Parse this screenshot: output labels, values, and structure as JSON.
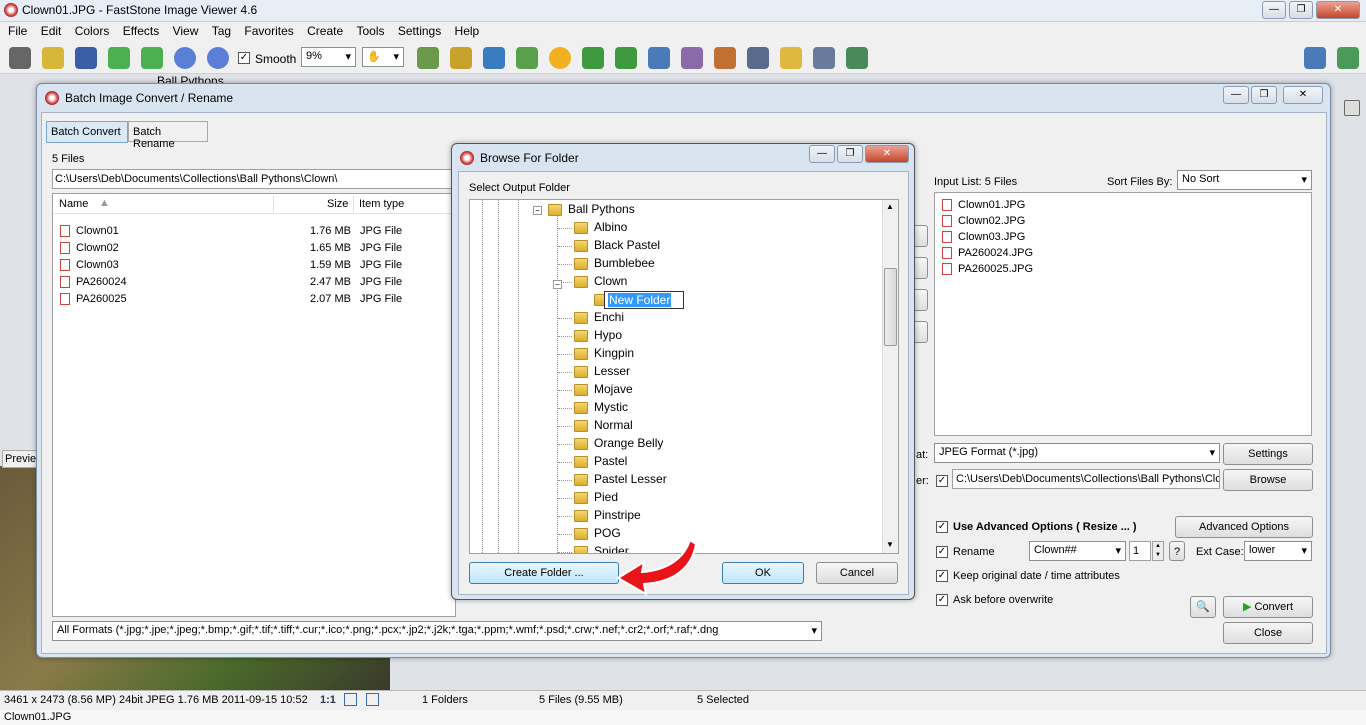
{
  "app": {
    "title": "Clown01.JPG  -  FastStone Image Viewer 4.6",
    "menu": [
      "File",
      "Edit",
      "Colors",
      "Effects",
      "View",
      "Tag",
      "Favorites",
      "Create",
      "Tools",
      "Settings",
      "Help"
    ],
    "smooth_label": "Smooth",
    "zoom_value": "9%",
    "behind_tree_item": "Ball Pythons",
    "preview_tab": "Previe"
  },
  "status": {
    "image_info": "3461 x 2473 (8.56 MP)  24bit  JPEG  1.76 MB  2011-09-15 10:52",
    "ratio": "1:1",
    "folders": "1 Folders",
    "files": "5 Files (9.55 MB)",
    "selected": "5 Selected",
    "filename": "Clown01.JPG"
  },
  "batch": {
    "title": "Batch Image Convert / Rename",
    "tabs": [
      "Batch Convert",
      "Batch Rename"
    ],
    "file_count": "5 Files",
    "path": "C:\\Users\\Deb\\Documents\\Collections\\Ball Pythons\\Clown\\",
    "columns": {
      "name": "Name",
      "size": "Size",
      "type": "Item type"
    },
    "files": [
      {
        "name": "Clown01",
        "size": "1.76 MB",
        "type": "JPG File"
      },
      {
        "name": "Clown02",
        "size": "1.65 MB",
        "type": "JPG File"
      },
      {
        "name": "Clown03",
        "size": "1.59 MB",
        "type": "JPG File"
      },
      {
        "name": "PA260024",
        "size": "2.47 MB",
        "type": "JPG File"
      },
      {
        "name": "PA260025",
        "size": "2.07 MB",
        "type": "JPG File"
      }
    ],
    "formats_filter": "All Formats (*.jpg;*.jpe;*.jpeg;*.bmp;*.gif;*.tif;*.tiff;*.cur;*.ico;*.png;*.pcx;*.jp2;*.j2k;*.tga;*.ppm;*.wmf;*.psd;*.crw;*.nef;*.cr2;*.orf;*.raf;*.dng",
    "input_list_label": "Input List:  5 Files",
    "sort_label": "Sort Files By:",
    "sort_value": "No Sort",
    "input_files": [
      "Clown01.JPG",
      "Clown02.JPG",
      "Clown03.JPG",
      "PA260024.JPG",
      "PA260025.JPG"
    ],
    "format_label": "at:",
    "format_value": "JPEG Format (*.jpg)",
    "settings_button": "Settings",
    "output_label": "er:",
    "output_path": "C:\\Users\\Deb\\Documents\\Collections\\Ball Pythons\\Clov",
    "browse_button": "Browse",
    "use_advanced": "Use Advanced Options ( Resize ... )",
    "advanced_button": "Advanced Options",
    "rename_label": "Rename",
    "rename_pattern": "Clown##",
    "rename_start": "1",
    "help_button": "?",
    "ext_case_label": "Ext Case:",
    "ext_case_value": "lower",
    "keep_date": "Keep original date / time attributes",
    "ask_overwrite": "Ask before overwrite",
    "convert_button": "Convert",
    "close_button": "Close"
  },
  "browse": {
    "title": "Browse For Folder",
    "prompt": "Select Output Folder",
    "parent": "Ball Pythons",
    "folders": [
      "Albino",
      "Black Pastel",
      "Bumblebee",
      "Clown"
    ],
    "new_folder": "New Folder",
    "folders_after": [
      "Enchi",
      "Hypo",
      "Kingpin",
      "Lesser",
      "Mojave",
      "Mystic",
      "Normal",
      "Orange Belly",
      "Pastel",
      "Pastel Lesser",
      "Pied",
      "Pinstripe",
      "POG",
      "Spider"
    ],
    "create_button": "Create Folder ...",
    "ok_button": "OK",
    "cancel_button": "Cancel"
  },
  "colors": {
    "accent": "#3399ff",
    "arrow": "#e8141a",
    "convert_icon": "#1fa81f"
  }
}
